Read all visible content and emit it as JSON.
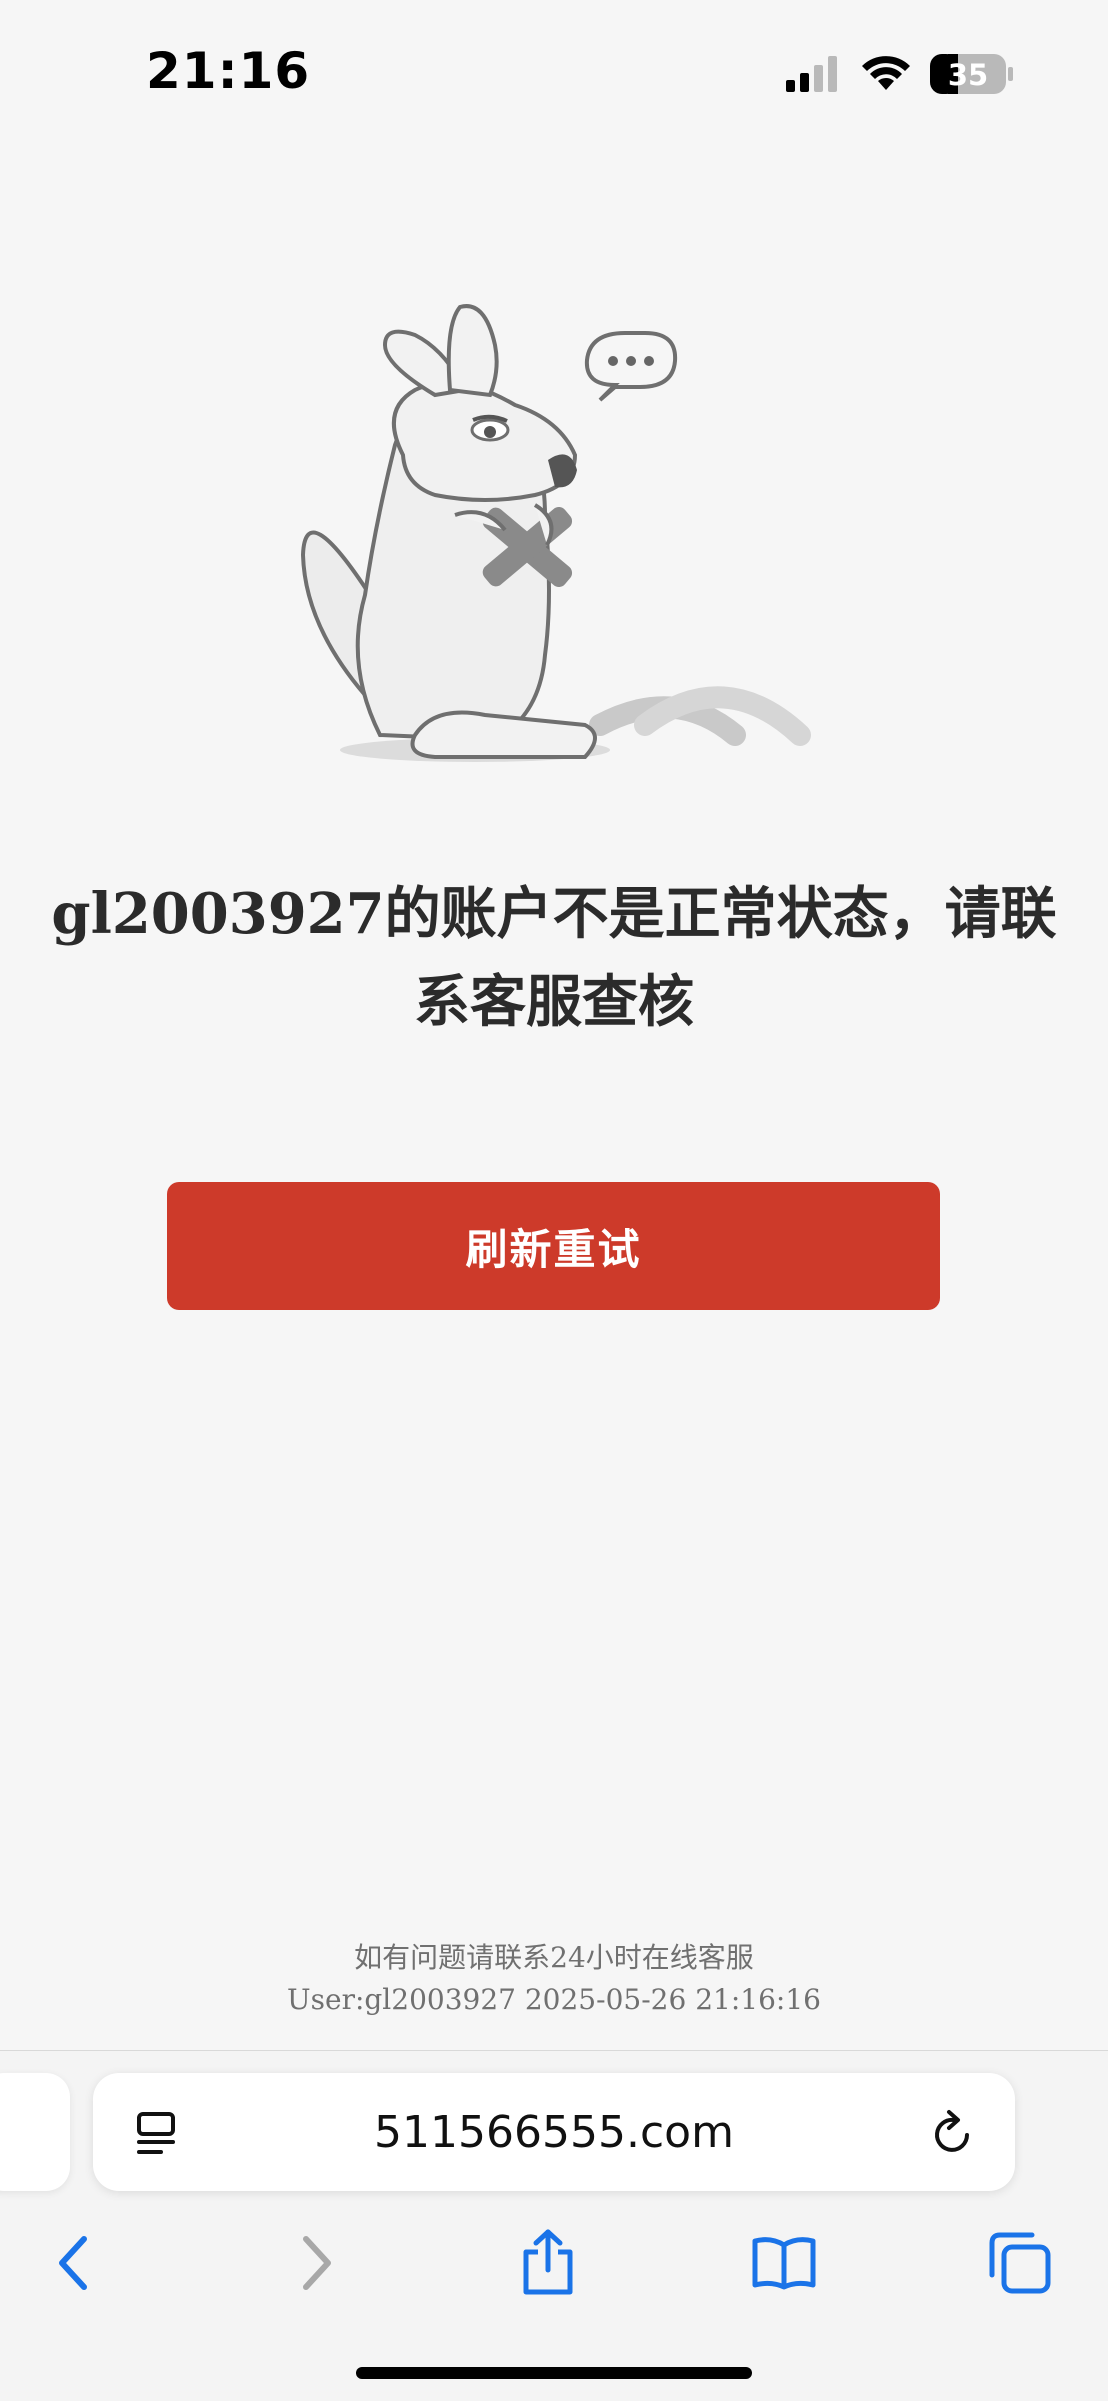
{
  "status_bar": {
    "time": "21:16",
    "battery_level": "35"
  },
  "main": {
    "message": "gl2003927的账户不是正常状态，请联系客服查核",
    "retry_label": "刷新重试",
    "footer_line1": "如有问题请联系24小时在线客服",
    "footer_line2": "User:gl2003927 2025-05-26 21:16:16"
  },
  "browser": {
    "url": "511566555.com",
    "icons": [
      "page-menu-icon",
      "reload-icon",
      "back-icon",
      "forward-icon",
      "share-icon",
      "bookmarks-icon",
      "tabs-icon"
    ]
  },
  "colors": {
    "background": "#f6f6f6",
    "button": "#cd3a2a",
    "accent": "#1a73e8"
  }
}
